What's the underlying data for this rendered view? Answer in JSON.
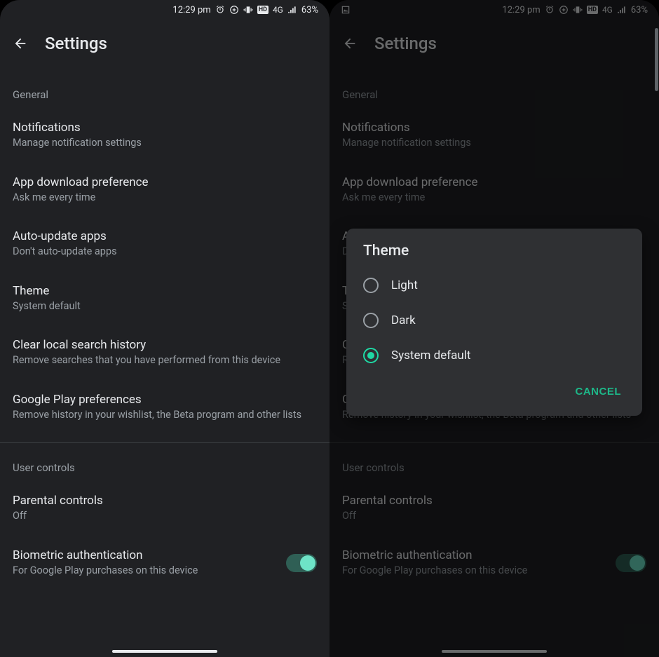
{
  "status": {
    "time": "12:29 pm",
    "network": "4G",
    "battery": "63%"
  },
  "appbar": {
    "title": "Settings"
  },
  "sections": {
    "general": {
      "label": "General",
      "items": {
        "notifications": {
          "title": "Notifications",
          "sub": "Manage notification settings"
        },
        "download_pref": {
          "title": "App download preference",
          "sub": "Ask me every time"
        },
        "auto_update": {
          "title": "Auto-update apps",
          "sub": "Don't auto-update apps"
        },
        "theme": {
          "title": "Theme",
          "sub": "System default"
        },
        "clear_search": {
          "title": "Clear local search history",
          "sub": "Remove searches that you have performed from this device"
        },
        "play_prefs": {
          "title": "Google Play preferences",
          "sub": "Remove history in your wishlist, the Beta program and other lists"
        }
      }
    },
    "user_controls": {
      "label": "User controls",
      "items": {
        "parental": {
          "title": "Parental controls",
          "sub": "Off"
        },
        "biometric": {
          "title": "Biometric authentication",
          "sub": "For Google Play purchases on this device"
        }
      }
    }
  },
  "dialog": {
    "title": "Theme",
    "options": {
      "light": "Light",
      "dark": "Dark",
      "system": "System default"
    },
    "cancel": "CANCEL"
  }
}
